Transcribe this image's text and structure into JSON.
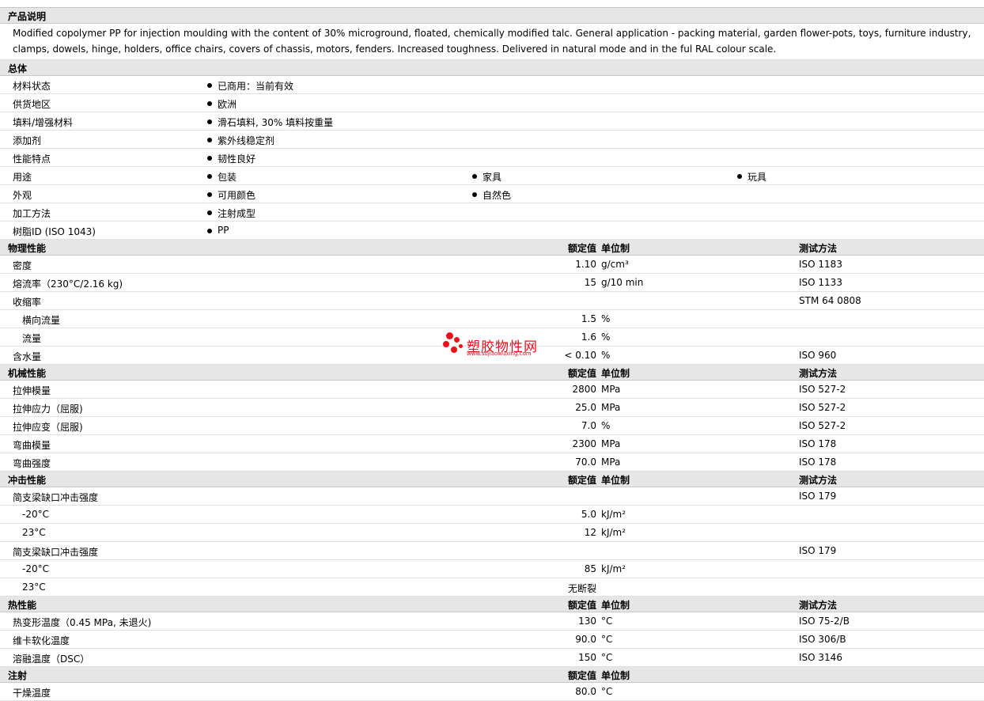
{
  "sections": {
    "description": {
      "title": "产品说明",
      "text": "Modified copolymer PP for injection moulding with the content of 30% microground, floated, chemically modified talc. General application - packing material, garden flower-pots, toys, furniture industry, clamps, dowels, hinge, holders, office chairs, covers of chassis, motors, fenders. Increased toughness. Delivered in natural mode and in the ful RAL colour scale."
    },
    "general": {
      "title": "总体",
      "rows": [
        {
          "label": "材料状态",
          "values": [
            "已商用：当前有效"
          ]
        },
        {
          "label": "供货地区",
          "values": [
            "欧洲"
          ]
        },
        {
          "label": "填料/增强材料",
          "values": [
            "滑石填料, 30% 填料按重量"
          ]
        },
        {
          "label": "添加剂",
          "values": [
            "紫外线稳定剂"
          ]
        },
        {
          "label": "性能特点",
          "values": [
            "韧性良好"
          ]
        },
        {
          "label": "用途",
          "values": [
            "包装",
            "家具",
            "玩具"
          ]
        },
        {
          "label": "外观",
          "values": [
            "可用颜色",
            "自然色"
          ]
        },
        {
          "label": "加工方法",
          "values": [
            "注射成型"
          ]
        },
        {
          "label": "树脂ID (ISO 1043)",
          "values": [
            "PP"
          ]
        }
      ]
    },
    "col_nominal": "额定值",
    "col_unit": "单位制",
    "col_test": "测试方法",
    "physical": {
      "title": "物理性能",
      "rows": [
        {
          "label": "密度",
          "value": "1.10",
          "unit": "g/cm³",
          "test": "ISO 1183"
        },
        {
          "label": "熔流率（230°C/2.16 kg)",
          "value": "15",
          "unit": "g/10 min",
          "test": "ISO 1133"
        },
        {
          "label": "收缩率",
          "value": "",
          "unit": "",
          "test": "STM 64 0808"
        },
        {
          "label": "横向流量",
          "value": "1.5",
          "unit": "%",
          "test": ""
        },
        {
          "label": "流量",
          "value": "1.6",
          "unit": "%",
          "test": ""
        },
        {
          "label": "含水量",
          "value": "< 0.10",
          "unit": "%",
          "test": "ISO 960"
        }
      ]
    },
    "mechanical": {
      "title": "机械性能",
      "rows": [
        {
          "label": "拉伸模量",
          "value": "2800",
          "unit": "MPa",
          "test": "ISO 527-2"
        },
        {
          "label": "拉伸应力（屈服)",
          "value": "25.0",
          "unit": "MPa",
          "test": "ISO 527-2"
        },
        {
          "label": "拉伸应变（屈服)",
          "value": "7.0",
          "unit": "%",
          "test": "ISO 527-2"
        },
        {
          "label": "弯曲模量",
          "value": "2300",
          "unit": "MPa",
          "test": "ISO 178"
        },
        {
          "label": "弯曲强度",
          "value": "70.0",
          "unit": "MPa",
          "test": "ISO 178"
        }
      ]
    },
    "impact": {
      "title": "冲击性能",
      "rows": [
        {
          "label": "简支梁缺口冲击强度",
          "value": "",
          "unit": "",
          "test": "ISO 179"
        },
        {
          "label": "-20°C",
          "value": "5.0",
          "unit": "kJ/m²",
          "test": ""
        },
        {
          "label": "23°C",
          "value": "12",
          "unit": "kJ/m²",
          "test": ""
        },
        {
          "label": "简支梁缺口冲击强度",
          "value": "",
          "unit": "",
          "test": "ISO 179"
        },
        {
          "label": "-20°C",
          "value": "85",
          "unit": "kJ/m²",
          "test": ""
        },
        {
          "label": "23°C",
          "value": "无断裂",
          "unit": "",
          "test": ""
        }
      ]
    },
    "thermal": {
      "title": "热性能",
      "rows": [
        {
          "label": "热变形温度（0.45 MPa, 未退火)",
          "value": "130",
          "unit": "°C",
          "test": "ISO 75-2/B"
        },
        {
          "label": "维卡软化温度",
          "value": "90.0",
          "unit": "°C",
          "test": "ISO 306/B"
        },
        {
          "label": "溶融温度（DSC）",
          "value": "150",
          "unit": "°C",
          "test": "ISO 3146"
        }
      ]
    },
    "injection": {
      "title": "注射",
      "rows": [
        {
          "label": "干燥温度",
          "value": "80.0",
          "unit": "°C",
          "test": ""
        }
      ]
    }
  },
  "watermark": {
    "text": "塑胶物性网",
    "url": "www.sujiaowuxing.com",
    "color": "#e8101c"
  }
}
